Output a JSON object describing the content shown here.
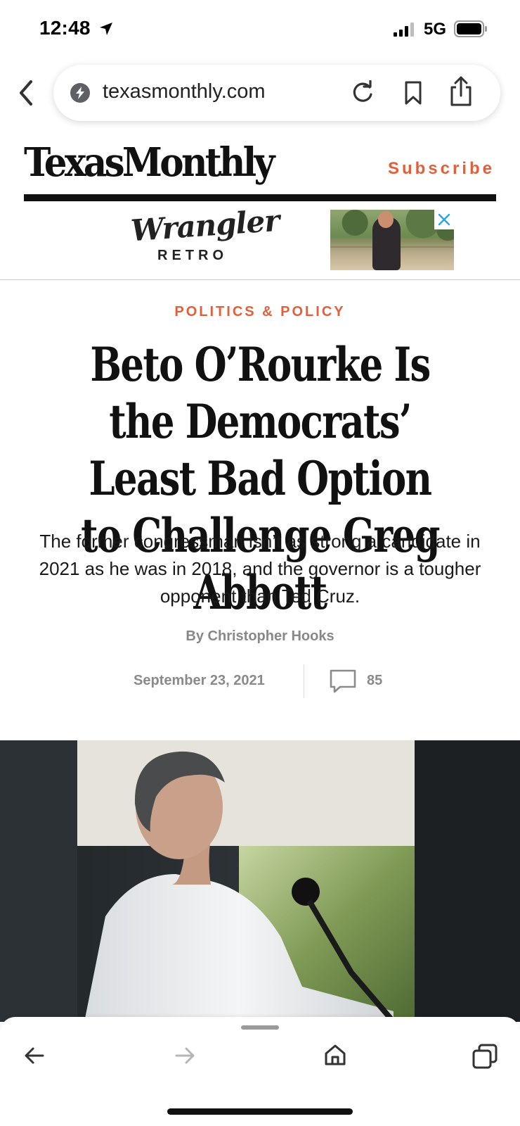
{
  "status_bar": {
    "time": "12:48",
    "network": "5G"
  },
  "browser": {
    "url": "texasmonthly.com"
  },
  "masthead": {
    "logo": "TexasMonthly",
    "subscribe_label": "Subscribe"
  },
  "ad": {
    "brand_script": "Wrangler",
    "brand_sub": "RETRO"
  },
  "article": {
    "category": "POLITICS & POLICY",
    "headline": "Beto O’Rourke Is the Democrats’ Least Bad Option to Challenge Greg Abbott",
    "dek": "The former congressman isn’t as strong a candidate in 2021 as he was in 2018, and the governor is a tougher opponent than Ted Cruz.",
    "byline": "By Christopher Hooks",
    "date": "September 23, 2021",
    "comment_count": "85"
  },
  "colors": {
    "accent": "#e0603c",
    "text": "#111111",
    "meta_gray": "#8a8a8a"
  },
  "icons": {
    "status": [
      "location-arrow-icon",
      "signal-icon",
      "battery-icon"
    ],
    "url_bar": [
      "back-chevron-icon",
      "site-info-icon",
      "reload-icon",
      "bookmark-icon",
      "share-icon"
    ],
    "toolbar": [
      "back-arrow-icon",
      "forward-arrow-icon",
      "home-icon",
      "tabs-icon"
    ]
  }
}
